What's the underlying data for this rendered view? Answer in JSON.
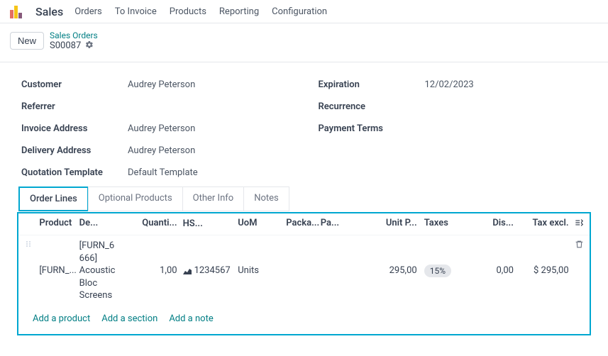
{
  "app": {
    "name": "Sales"
  },
  "nav": {
    "orders": "Orders",
    "to_invoice": "To Invoice",
    "products": "Products",
    "reporting": "Reporting",
    "configuration": "Configuration"
  },
  "subbar": {
    "new_label": "New",
    "breadcrumb_top": "Sales Orders",
    "record": "S00087"
  },
  "form": {
    "left": {
      "customer_label": "Customer",
      "customer_value": "Audrey Peterson",
      "referrer_label": "Referrer",
      "referrer_value": "",
      "invoice_addr_label": "Invoice Address",
      "invoice_addr_value": "Audrey Peterson",
      "delivery_addr_label": "Delivery Address",
      "delivery_addr_value": "Audrey Peterson",
      "quote_tmpl_label": "Quotation Template",
      "quote_tmpl_value": "Default Template"
    },
    "right": {
      "expiration_label": "Expiration",
      "expiration_value": "12/02/2023",
      "recurrence_label": "Recurrence",
      "recurrence_value": "",
      "payment_terms_label": "Payment Terms",
      "payment_terms_value": ""
    }
  },
  "tabs": {
    "order_lines": "Order Lines",
    "optional_products": "Optional Products",
    "other_info": "Other Info",
    "notes": "Notes"
  },
  "grid": {
    "head": {
      "product": "Product",
      "desc": "De...",
      "qty": "Quanti...",
      "hs": "HS...",
      "uom": "UoM",
      "packa": "Packa...",
      "pa": "Pa...",
      "unitprice": "Unit P...",
      "taxes": "Taxes",
      "disc": "Dis...",
      "taxexcl": "Tax excl."
    },
    "rows": [
      {
        "product": "[FURN_...",
        "desc_l1": "[FURN_6",
        "desc_l2": "666]",
        "desc_l3": "Acoustic",
        "desc_l4": "Bloc",
        "desc_l5": "Screens",
        "qty": "1,00",
        "hs": "1234567",
        "uom": "Units",
        "packa": "",
        "pa": "",
        "unitprice": "295,00",
        "taxes": "15%",
        "disc": "0,00",
        "taxexcl": "$ 295,00"
      }
    ],
    "actions": {
      "add_product": "Add a product",
      "add_section": "Add a section",
      "add_note": "Add a note"
    }
  }
}
